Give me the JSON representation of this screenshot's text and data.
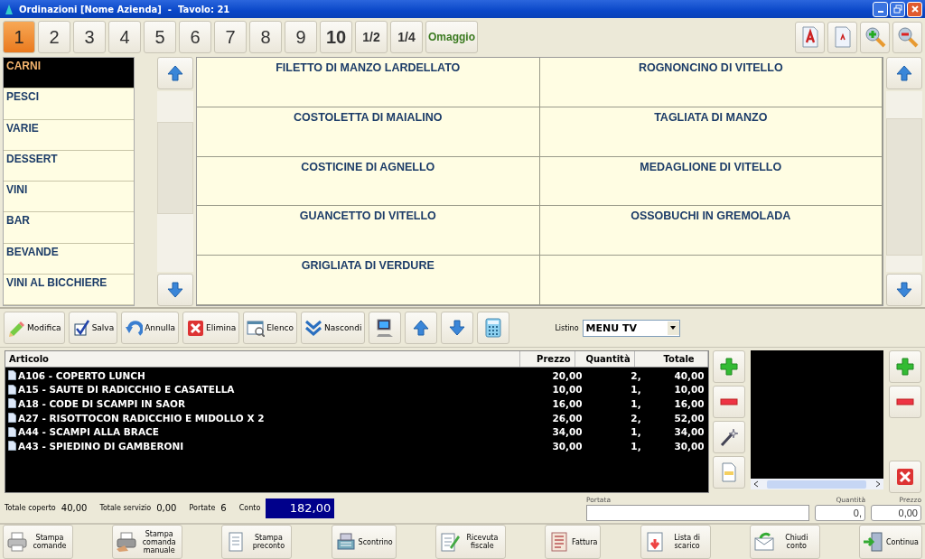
{
  "window": {
    "title": "Ordinazioni [Nome Azienda]  -  Tavolo: 21"
  },
  "portions": [
    {
      "label": "1",
      "selected": true
    },
    {
      "label": "2",
      "selected": false
    },
    {
      "label": "3",
      "selected": false
    },
    {
      "label": "4",
      "selected": false
    },
    {
      "label": "5",
      "selected": false
    },
    {
      "label": "6",
      "selected": false
    },
    {
      "label": "7",
      "selected": false
    },
    {
      "label": "8",
      "selected": false
    },
    {
      "label": "9",
      "selected": false
    },
    {
      "label": "10",
      "selected": false
    },
    {
      "label": "1/2",
      "selected": false
    },
    {
      "label": "1/4",
      "selected": false
    },
    {
      "label": "Omaggio",
      "selected": false
    }
  ],
  "categories": [
    {
      "label": "CARNI",
      "selected": true
    },
    {
      "label": "PESCI",
      "selected": false
    },
    {
      "label": "VARIE",
      "selected": false
    },
    {
      "label": "DESSERT",
      "selected": false
    },
    {
      "label": "VINI",
      "selected": false
    },
    {
      "label": "BAR",
      "selected": false
    },
    {
      "label": "BEVANDE",
      "selected": false
    },
    {
      "label": "VINI AL BICCHIERE",
      "selected": false
    }
  ],
  "products": [
    "FILETTO DI MANZO LARDELLATO",
    "ROGNONCINO DI VITELLO",
    "COSTOLETTA DI MAIALINO",
    "TAGLIATA DI MANZO",
    "COSTICINE DI AGNELLO",
    "MEDAGLIONE DI VITELLO",
    "GUANCETTO DI VITELLO",
    "OSSOBUCHI IN GREMOLADA",
    "GRIGLIATA DI VERDURE"
  ],
  "toolbar": {
    "buttons": [
      "Modifica",
      "Salva",
      "Annulla",
      "Elimina",
      "Elenco",
      "Nascondi"
    ],
    "listino_label": "Listino",
    "listino_value": "MENU TV"
  },
  "order": {
    "columns": [
      "Articolo",
      "Prezzo",
      "Quantità",
      "Totale"
    ],
    "rows": [
      {
        "articolo": "A106 - COPERTO LUNCH",
        "prezzo": "20,00",
        "quantita": "2,",
        "totale": "40,00"
      },
      {
        "articolo": "A15 - SAUTE DI RADICCHIO E CASATELLA",
        "prezzo": "10,00",
        "quantita": "1,",
        "totale": "10,00"
      },
      {
        "articolo": "A18 - CODE DI SCAMPI IN SAOR",
        "prezzo": "16,00",
        "quantita": "1,",
        "totale": "16,00"
      },
      {
        "articolo": "A27 - RISOTTOCON RADICCHIO E MIDOLLO X 2",
        "prezzo": "26,00",
        "quantita": "2,",
        "totale": "52,00"
      },
      {
        "articolo": "A44 - SCAMPI ALLA BRACE",
        "prezzo": "34,00",
        "quantita": "1,",
        "totale": "34,00"
      },
      {
        "articolo": "A43 - SPIEDINO DI GAMBERONI",
        "prezzo": "30,00",
        "quantita": "1,",
        "totale": "30,00"
      }
    ]
  },
  "totals": {
    "coperto_label": "Totale coperto",
    "coperto": "40,00",
    "servizio_label": "Totale servizio",
    "servizio": "0,00",
    "portate_label": "Portate",
    "portate": "6",
    "conto_label": "Conto",
    "conto": "182,00"
  },
  "entry": {
    "portata_label": "Portata",
    "quantita_label": "Quantità",
    "quantita": "0,",
    "prezzo_label": "Prezzo",
    "prezzo": "0,00"
  },
  "actions": [
    "Stampa comande",
    "Stampa comanda manuale",
    "Stampa preconto",
    "Scontrino",
    "Ricevuta fiscale",
    "Fattura",
    "Lista di scarico",
    "Chiudi conto",
    "Continua"
  ]
}
